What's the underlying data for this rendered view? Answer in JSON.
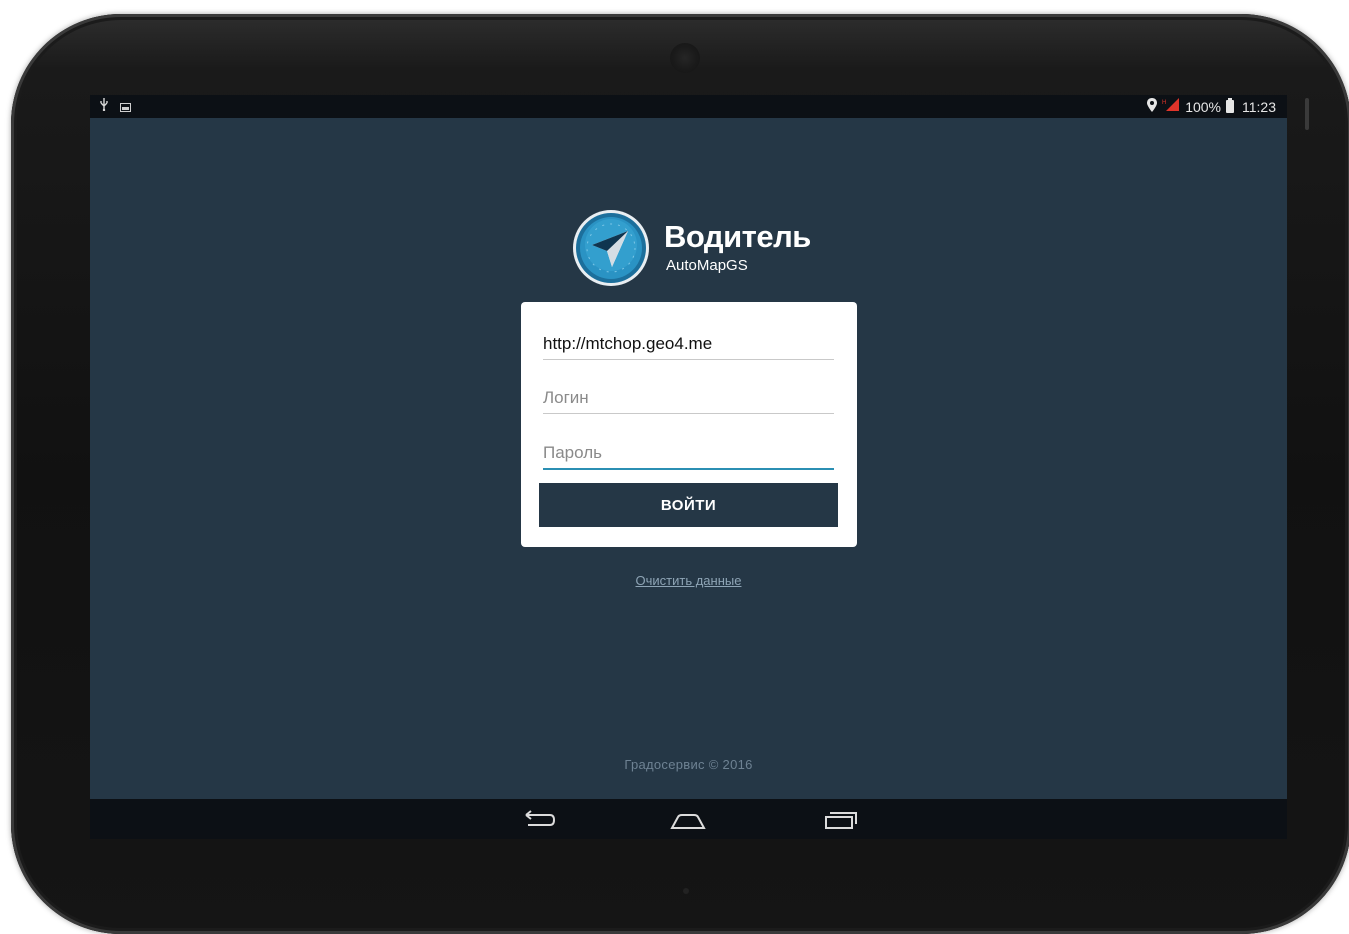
{
  "status_bar": {
    "left_icons": [
      "usb-icon",
      "image-icon"
    ],
    "right_icons": [
      "location-icon",
      "signal-icon",
      "battery-icon"
    ],
    "battery": "100%",
    "time": "11:23"
  },
  "app": {
    "title": "Водитель",
    "subtitle": "AutoMapGS"
  },
  "form": {
    "server_value": "http://mtchop.geo4.me",
    "login_placeholder": "Логин",
    "password_placeholder": "Пароль",
    "submit_label": "ВОЙТИ"
  },
  "clear_link": "Очистить данные",
  "footer": "Градосервис © 2016",
  "nav_bar": [
    "back-icon",
    "home-icon",
    "recent-apps-icon"
  ],
  "colors": {
    "screen_bg": "#253746",
    "accent": "#2b8fb3",
    "button": "#253746"
  }
}
